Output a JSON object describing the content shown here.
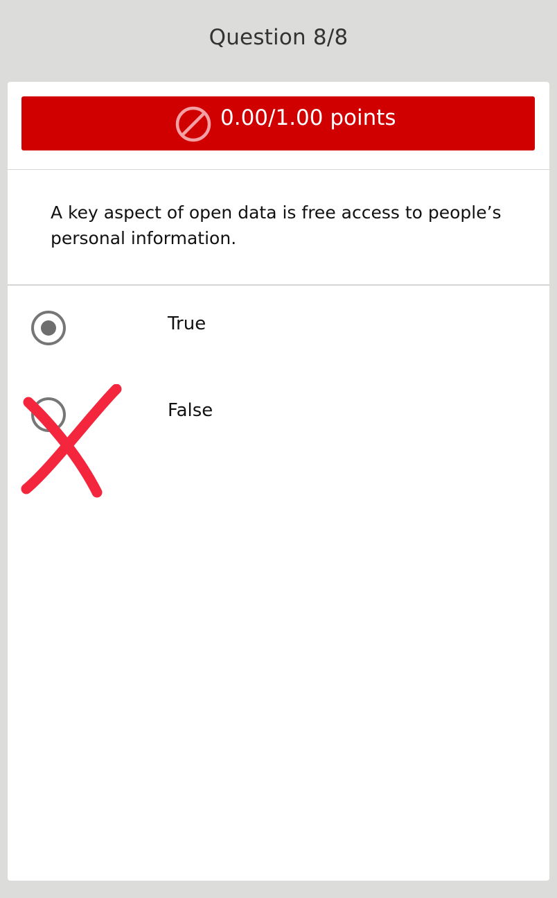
{
  "header": {
    "title": "Question 8/8"
  },
  "score": {
    "text": "0.00/1.00 points",
    "icon": "no-entry-icon",
    "color": "#d10000"
  },
  "question": {
    "text": "A key aspect of open data is free access to people’s personal information."
  },
  "options": [
    {
      "label": "True",
      "selected": true
    },
    {
      "label": "False",
      "selected": false
    }
  ],
  "feedback": {
    "icon": "cross-mark-icon",
    "color": "#f4263d"
  }
}
